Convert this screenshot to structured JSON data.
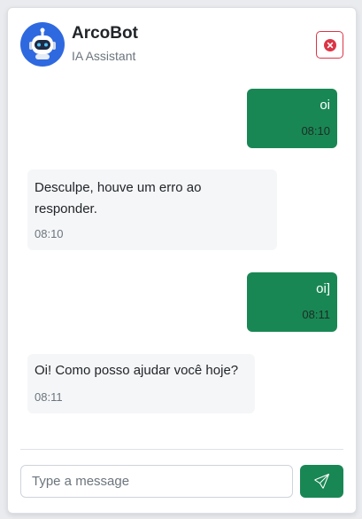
{
  "header": {
    "bot_name": "ArcoBot",
    "subtitle": "IA Assistant",
    "avatar_icon": "robot-icon",
    "close_icon": "close-circle-icon"
  },
  "messages": [
    {
      "sender": "user",
      "text": "oi",
      "time": "08:10"
    },
    {
      "sender": "bot",
      "text": "Desculpe, houve um erro ao responder.",
      "time": "08:10"
    },
    {
      "sender": "user",
      "text": "oi]",
      "time": "08:11"
    },
    {
      "sender": "bot",
      "text": "Oi! Como posso ajudar você hoje?",
      "time": "08:11"
    }
  ],
  "composer": {
    "placeholder": "Type a message",
    "value": "",
    "send_icon": "send-icon"
  },
  "colors": {
    "primary": "#198754",
    "danger": "#dc3545",
    "avatar": "#2f69e0",
    "bot_bubble": "#f5f6f8"
  }
}
